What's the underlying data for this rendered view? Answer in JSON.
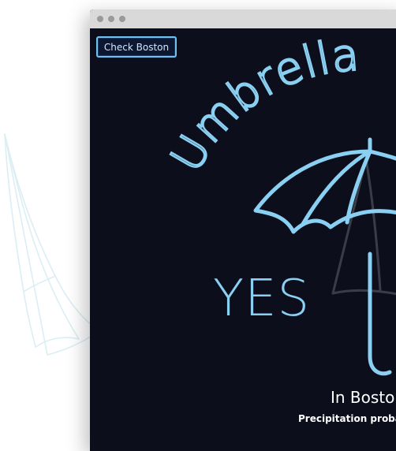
{
  "window": {
    "title_dots": 3
  },
  "button": {
    "label": "Check Boston"
  },
  "heading": {
    "title": "Umbrella"
  },
  "answer": {
    "text": "YES"
  },
  "location": {
    "text": "In Boston"
  },
  "precipitation": {
    "text": "Precipitation probabi"
  },
  "colors": {
    "background": "#0c0f1b",
    "accent": "#8ad0f2",
    "ghost_umbrella": "#3a3d48",
    "text": "#ffffff"
  }
}
